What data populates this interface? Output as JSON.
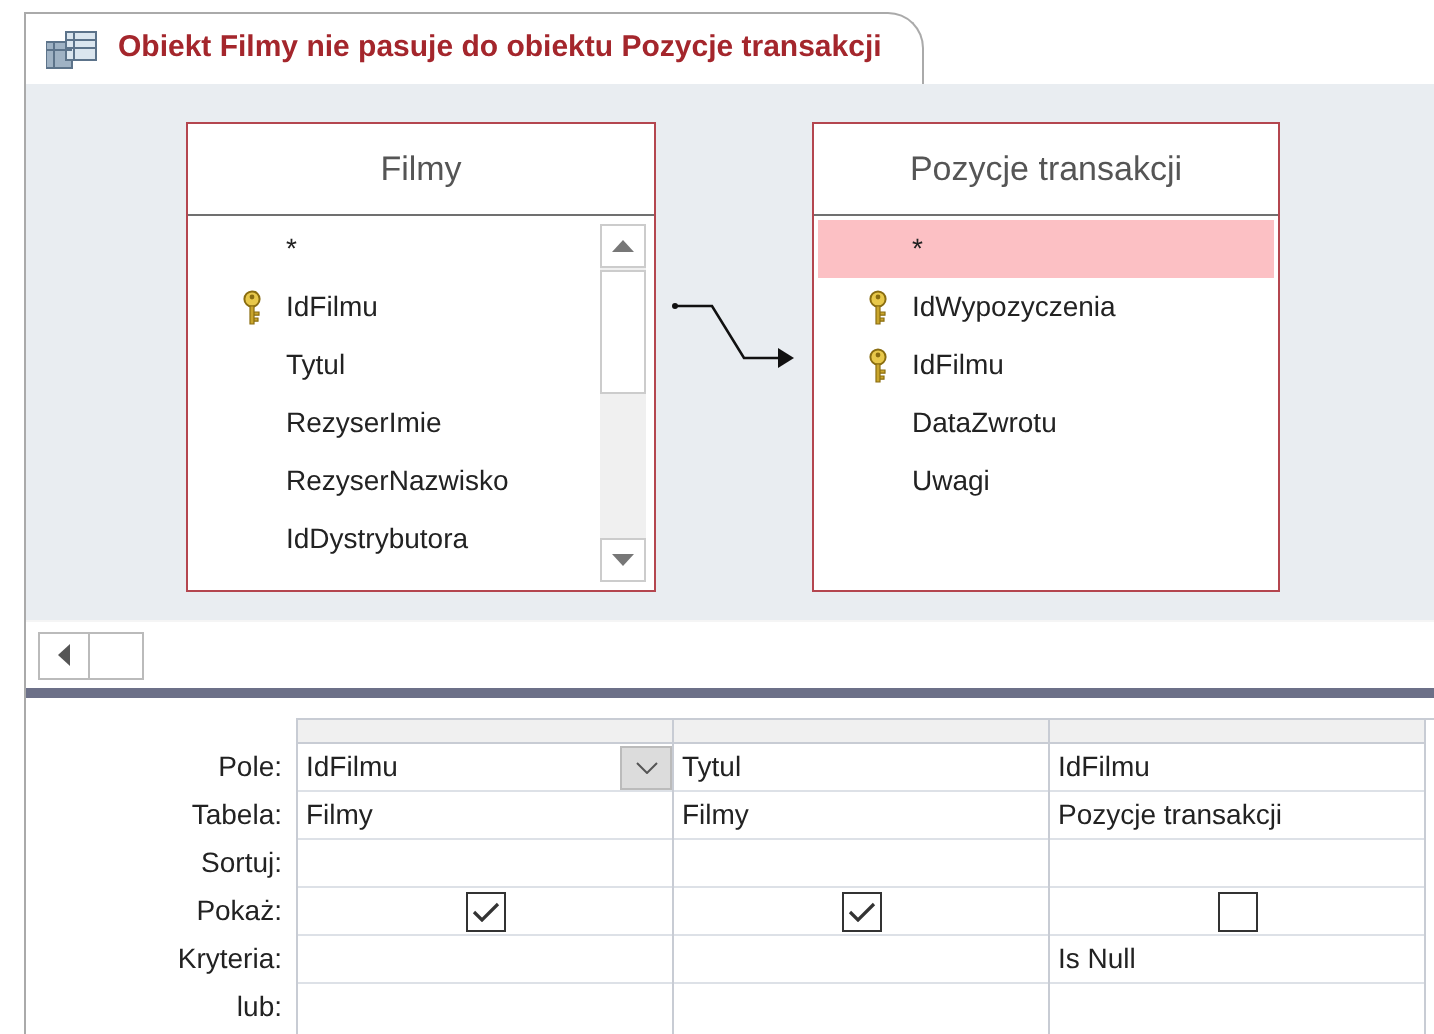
{
  "tab": {
    "title": "Obiekt Filmy nie pasuje do obiektu Pozycje transakcji"
  },
  "tables": [
    {
      "name": "Filmy",
      "scrollbar": true,
      "fields": [
        {
          "name": "*",
          "primary_key": false,
          "selected": false
        },
        {
          "name": "IdFilmu",
          "primary_key": true,
          "selected": false
        },
        {
          "name": "Tytul",
          "primary_key": false,
          "selected": false
        },
        {
          "name": "RezyserImie",
          "primary_key": false,
          "selected": false
        },
        {
          "name": "RezyserNazwisko",
          "primary_key": false,
          "selected": false
        },
        {
          "name": "IdDystrybutora",
          "primary_key": false,
          "selected": false
        }
      ]
    },
    {
      "name": "Pozycje transakcji",
      "scrollbar": false,
      "fields": [
        {
          "name": "*",
          "primary_key": false,
          "selected": true
        },
        {
          "name": "IdWypozyczenia",
          "primary_key": true,
          "selected": false
        },
        {
          "name": "IdFilmu",
          "primary_key": true,
          "selected": false
        },
        {
          "name": "DataZwrotu",
          "primary_key": false,
          "selected": false
        },
        {
          "name": "Uwagi",
          "primary_key": false,
          "selected": false
        }
      ]
    }
  ],
  "grid": {
    "row_labels": [
      "Pole:",
      "Tabela:",
      "Sortuj:",
      "Pokaż:",
      "Kryteria:",
      "lub:"
    ],
    "columns": [
      {
        "field": "IdFilmu",
        "table": "Filmy",
        "show": true,
        "active": true
      },
      {
        "field": "Tytul",
        "table": "Filmy",
        "show": true,
        "active": false
      },
      {
        "field": "IdFilmu",
        "table": "Pozycje transakcji",
        "show": false,
        "active": false,
        "criteria": "Is Null"
      }
    ]
  }
}
